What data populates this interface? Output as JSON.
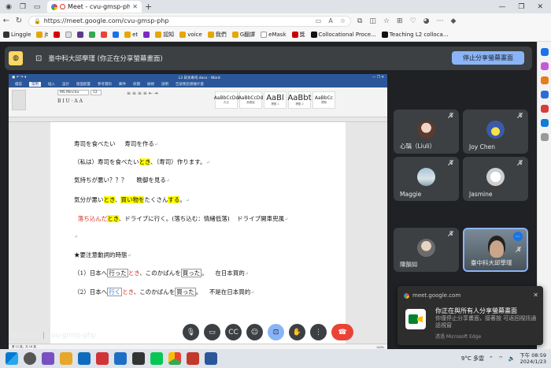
{
  "browser": {
    "tab_title": "Meet - cvu-gmsp-php",
    "url": "https://meet.google.com/cvu-gmsp-php",
    "bookmarks": [
      "Linggle",
      "jt",
      "",
      "",
      "",
      "",
      "",
      "",
      "et",
      "",
      "認知",
      "voice",
      "我們",
      "G翻譯",
      "eMask",
      "獎",
      "Collocational Proce...",
      "Teaching L2 colloca..."
    ]
  },
  "meet": {
    "presenting_text": "臺中科大邱學瑾 (你正在分享螢幕畫面)",
    "stop_share_label": "停止分享螢幕畫面",
    "time": "晚上8:59",
    "meeting_code": "cvu-gmsp-php",
    "participants": [
      {
        "name": "心璃（Liuli）",
        "muted": true
      },
      {
        "name": "Joy Chen",
        "muted": true
      },
      {
        "name": "Maggie",
        "muted": true
      },
      {
        "name": "Jasmine",
        "muted": true
      },
      {
        "name": "陳韻如",
        "muted": true
      },
      {
        "name": "臺中科大邱學瑾",
        "muted": true
      }
    ],
    "controls": [
      "mic-icon",
      "camera-icon",
      "captions-icon",
      "emoji-icon",
      "present-icon",
      "raise-hand-icon",
      "more-icon",
      "end-call-icon"
    ]
  },
  "word": {
    "title": "L3 日文寿司.docx - Word",
    "menu": [
      "檔案",
      "常用",
      "插入",
      "設計",
      "版面配置",
      "參考資料",
      "郵件",
      "校閱",
      "檢視",
      "說明",
      "告訴我您想做什麼"
    ],
    "font": "MS Mincho",
    "font_size": "12",
    "styles": [
      {
        "sample": "AaBbCcDd",
        "caption": "內文"
      },
      {
        "sample": "AaBbCcDd",
        "caption": "無間距"
      },
      {
        "sample": "AaBl",
        "caption": "標題 1"
      },
      {
        "sample": "AaBbt",
        "caption": "標題 2"
      },
      {
        "sample": "AaBbCc",
        "caption": "標題"
      }
    ],
    "status_left": "第 12 頁，共 18 頁",
    "status_zoom": "140%",
    "lines": {
      "l1a": "寿司を食べたい",
      "l1b": "寿司を作る",
      "l2a": "（私は）寿司を食べたい",
      "l2hl": "とき",
      "l2b": "、（寿司）作ります。",
      "l3a": "気持ちが悪い？？？",
      "l3b": "晩御を見る",
      "l4a": "気分が悪い",
      "l4hl1": "とき",
      "l4b": "、",
      "l4hl2": "買い物を",
      "l4c": "たくさん",
      "l4hl3": "する",
      "l4d": "。",
      "l5a": "落ち込んだ",
      "l5hl": "とき",
      "l5b": "、ドライブに行く。(落ち込む：情緒低落)",
      "l5c": "ドライブ開車兜風",
      "l6": "★要注意動詞的時態",
      "l7a": "（1）日本へ",
      "l7box": "行った",
      "l7red": "とき",
      "l7b": "、このかばんを",
      "l7box2": "買った",
      "l7c": "。",
      "l7d": "在日本買的",
      "l8a": "（2）日本へ",
      "l8box": "行く",
      "l8red": "とき",
      "l8b": "、このかばんを",
      "l8box2": "買った",
      "l8c": "。",
      "l8d": "不是在日本買的"
    }
  },
  "toast": {
    "source": "meet.google.com",
    "title": "你正在與所有人分享螢幕畫面",
    "body": "你僅停止分享畫面，接著按 可返回視訊通話視窗",
    "via": "透過 Microsoft Edge"
  },
  "taskbar": {
    "weather": "9°C 多雲",
    "time": "下午 08:59",
    "date": "2024/1/23"
  },
  "colors": {
    "meet_bg": "#202124",
    "tile_bg": "#3c4043",
    "accent": "#8ab4f8",
    "end_call": "#ea4335",
    "highlight": "#ffff00",
    "word_blue": "#2b579a"
  }
}
